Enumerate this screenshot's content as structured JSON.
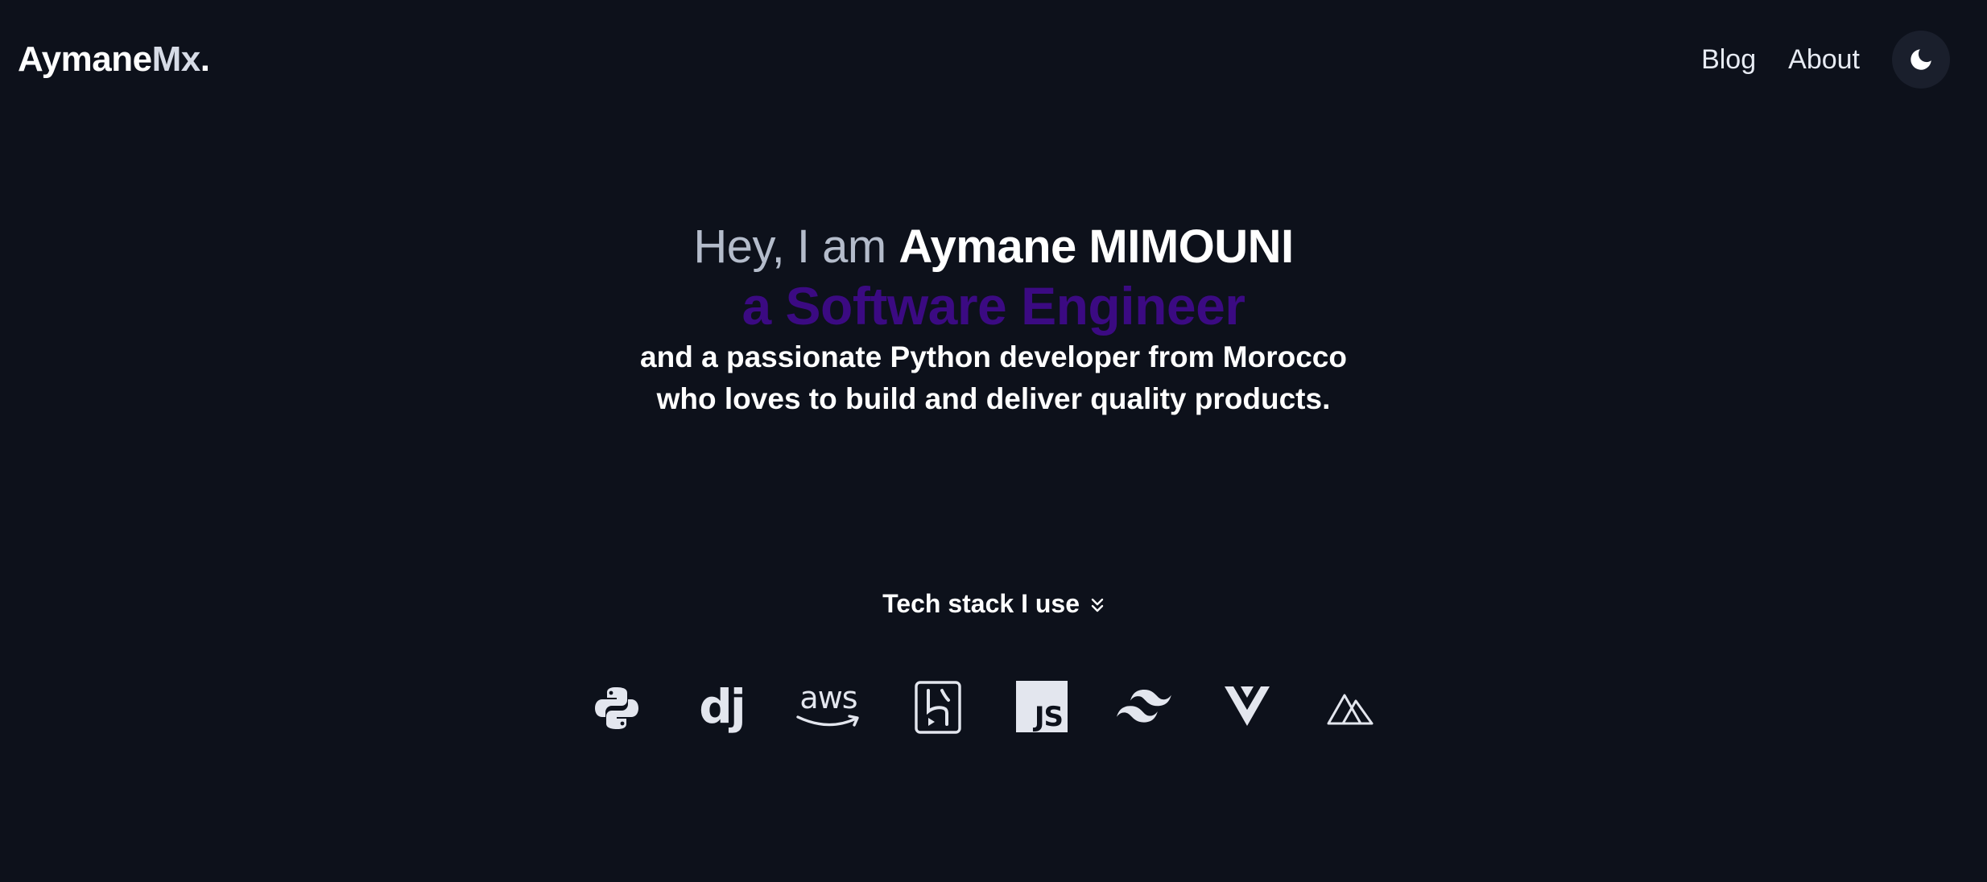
{
  "header": {
    "brand_main": "Aymane",
    "brand_accent": "Mx",
    "brand_dot": ".",
    "nav": {
      "blog": "Blog",
      "about": "About"
    },
    "theme_toggle_icon": "moon-icon"
  },
  "hero": {
    "greeting_prefix": "Hey, I am",
    "name": "Aymane MIMOUNI",
    "role": "a Software Engineer",
    "description_line1": "and a passionate Python developer from Morocco",
    "description_line2": "who loves to build and deliver quality products."
  },
  "stack": {
    "title": "Tech stack I use",
    "title_icon": "double-chevron-down-icon",
    "icons": [
      "python-icon",
      "django-icon",
      "aws-icon",
      "heroku-icon",
      "javascript-icon",
      "tailwind-icon",
      "vue-icon",
      "nuxt-icon"
    ],
    "labels": {
      "django": "dj",
      "aws": "aws",
      "javascript": "JS"
    }
  },
  "colors": {
    "background": "#0d111b",
    "role_accent": "#3b0a82",
    "icon_color": "#e3e6ee"
  }
}
